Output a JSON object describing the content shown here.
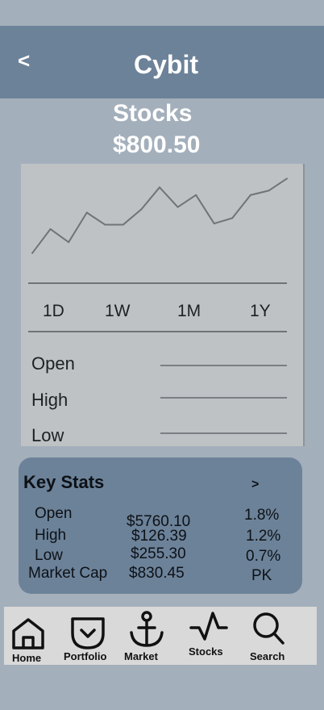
{
  "header": {
    "back_label": "<",
    "title": "Cybit"
  },
  "stock": {
    "name": "Stocks",
    "price": "$800.50"
  },
  "chart_data": {
    "type": "line",
    "categories": [
      "1D",
      "1W",
      "1M",
      "1Y"
    ],
    "selected_range": "",
    "series": [
      {
        "values": [
          20,
          42,
          30,
          57,
          46,
          46,
          60,
          80,
          62,
          73,
          47,
          52,
          73,
          77,
          88
        ]
      }
    ],
    "ylim": [
      0,
      100
    ],
    "grid": false
  },
  "price_stats": {
    "rows": [
      {
        "label": "Open",
        "value": ""
      },
      {
        "label": "High",
        "value": ""
      },
      {
        "label": "Low",
        "value": ""
      }
    ]
  },
  "key_stats": {
    "title": "Key Stats",
    "chevron": ">",
    "rows": [
      {
        "label": "Open",
        "value": "$5760.10",
        "change": "1.8%"
      },
      {
        "label": "High",
        "value": "$126.39",
        "change": "1.2%"
      },
      {
        "label": "Low",
        "value": "$255.30",
        "change": "0.7%"
      },
      {
        "label": "Market Cap",
        "value": "$830.45",
        "change": "PK"
      }
    ]
  },
  "nav": {
    "items": [
      {
        "label": "Home",
        "icon": "home-icon"
      },
      {
        "label": "Portfolio",
        "icon": "pocket-icon"
      },
      {
        "label": "Market",
        "icon": "anchor-icon"
      },
      {
        "label": "Stocks",
        "icon": "activity-icon"
      },
      {
        "label": "Search",
        "icon": "search-icon"
      }
    ]
  },
  "colors": {
    "background": "#a3afbb",
    "header": "#6c8299",
    "chart_card": "#bfc2c4",
    "nav_bar": "#d9d9d9",
    "line": "#6f7478"
  }
}
